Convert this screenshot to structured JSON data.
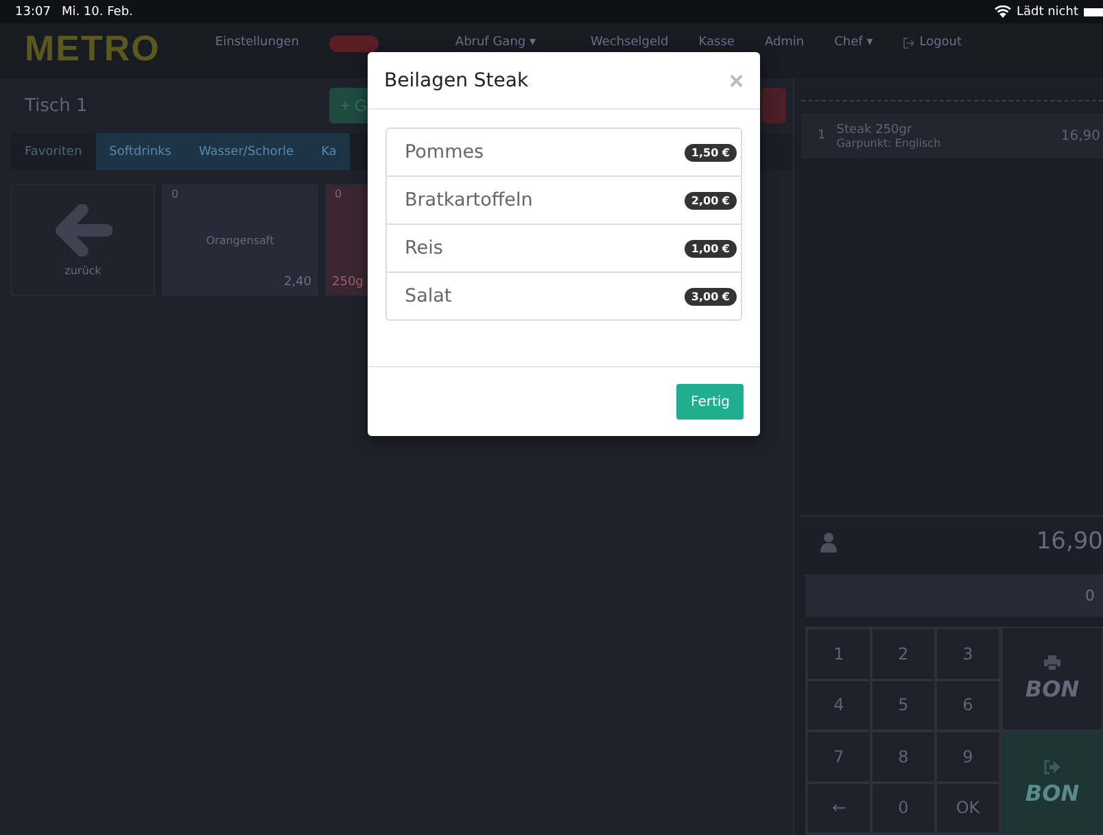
{
  "status_bar": {
    "time": "13:07",
    "date": "Mi. 10. Feb.",
    "battery_text": "Lädt nicht"
  },
  "nav": {
    "logo": "METRO",
    "items": [
      {
        "label": "Einstellungen",
        "kind": "link"
      },
      {
        "kind": "badge"
      },
      {
        "label": "Abruf Gang ▾",
        "kind": "link"
      },
      {
        "label": "Wechselgeld",
        "kind": "link"
      },
      {
        "label": "Kasse",
        "kind": "link"
      },
      {
        "label": "Admin",
        "kind": "link"
      },
      {
        "label": "Chef ▾",
        "kind": "link"
      },
      {
        "label": "Logout",
        "kind": "logout"
      }
    ]
  },
  "table_title": "Tisch 1",
  "action_buttons": [
    {
      "label": "+ G",
      "kind": "add"
    },
    {
      "kind": "delete"
    }
  ],
  "category_tabs": [
    {
      "label": "Favoriten",
      "selected": true
    },
    {
      "label": "Softdrinks",
      "selected": false
    },
    {
      "label": "Wasser/Schorle",
      "selected": false
    },
    {
      "label": "Ka",
      "selected": false
    }
  ],
  "products": [
    {
      "kind": "back",
      "name": "zurück"
    },
    {
      "kind": "product",
      "count": "0",
      "name": "Orangensaft",
      "price": "2,40",
      "color": "#262a36"
    },
    {
      "kind": "product",
      "count": "0",
      "price": "250g",
      "color": "#3a2630"
    }
  ],
  "order": {
    "items": [
      {
        "qty": "1",
        "name": "Steak 250gr",
        "note": "Garpunkt: Englisch",
        "price": "16,90"
      }
    ],
    "total": "16,90",
    "input": "0",
    "keys": [
      "1",
      "2",
      "3",
      "4",
      "5",
      "6",
      "7",
      "8",
      "9",
      "←",
      "0",
      "OK"
    ],
    "bon_buttons": [
      {
        "label": "BON",
        "kind": "print"
      },
      {
        "label": "BON",
        "kind": "send"
      }
    ]
  },
  "modal": {
    "title": "Beilagen Steak",
    "close": "×",
    "options": [
      {
        "name": "Pommes",
        "price": "1,50 €"
      },
      {
        "name": "Bratkartoffeln",
        "price": "2,00 €"
      },
      {
        "name": "Reis",
        "price": "1,00 €"
      },
      {
        "name": "Salat",
        "price": "3,00 €"
      }
    ],
    "button": "Fertig"
  }
}
